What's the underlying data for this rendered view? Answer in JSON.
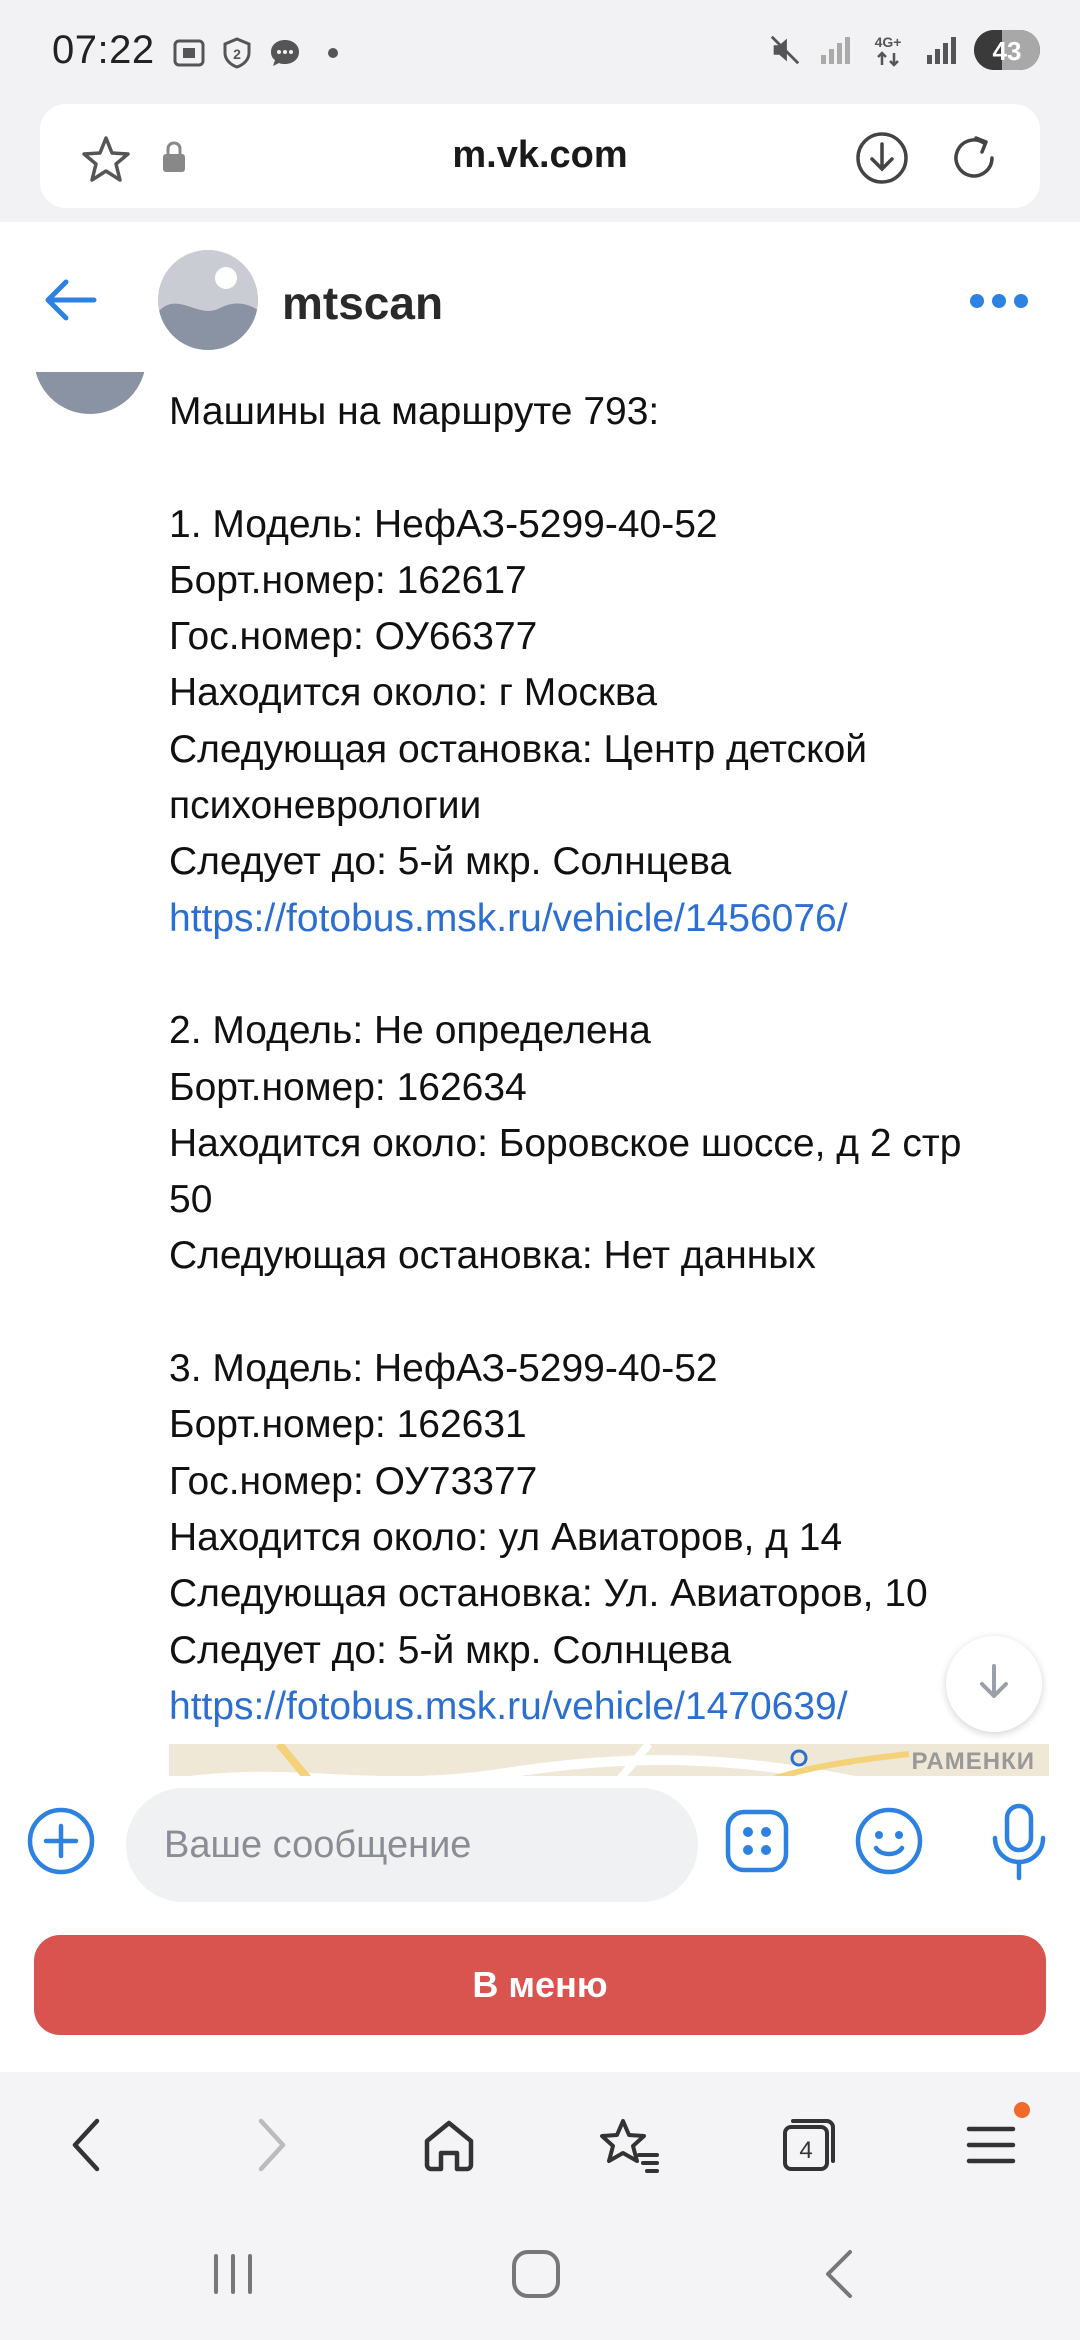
{
  "status_bar": {
    "time": "07:22",
    "network": "4G+",
    "battery": "43",
    "battery_level_percent": 43,
    "icons": [
      "screenshot-icon",
      "shield-2-icon",
      "message-icon",
      "dot-icon",
      "mute-icon",
      "signal-icon",
      "signal-4g-icon",
      "signal-icon"
    ]
  },
  "browser": {
    "url": "m.vk.com",
    "open_tabs": "4"
  },
  "chat": {
    "title": "mtscan",
    "composer_placeholder": "Ваше сообщение",
    "menu_button": "В меню",
    "map_label": "РАМЕНКИ",
    "accent_color": "#2d81e0",
    "button_color": "#d9534f"
  },
  "message": {
    "header": "Машины на маршруте 793:",
    "vehicles": [
      {
        "model": "1. Модель: НефАЗ-5299-40-52",
        "board": "Борт.номер: 162617",
        "gos": "Гос.номер: ОУ66377",
        "near": "Находится около: г Москва",
        "next_stop_1": "Следующая остановка: Центр детской",
        "next_stop_2": "психоневрологии",
        "dest": "Следует до: 5-й мкр. Солнцева",
        "link": "https://fotobus.msk.ru/vehicle/1456076/"
      },
      {
        "model": "2. Модель: Не определена",
        "board": "Борт.номер: 162634",
        "near_1": "Находится около: Боровское шоссе, д 2 стр",
        "near_2": "50",
        "next_stop": "Следующая остановка: Нет данных"
      },
      {
        "model": "3. Модель: НефАЗ-5299-40-52",
        "board": "Борт.номер: 162631",
        "gos": "Гос.номер: ОУ73377",
        "near": "Находится около: ул Авиаторов, д 14",
        "next_stop": "Следующая остановка: Ул. Авиаторов, 10",
        "dest": "Следует до: 5-й мкр. Солнцева",
        "link": "https://fotobus.msk.ru/vehicle/1470639/"
      }
    ]
  }
}
